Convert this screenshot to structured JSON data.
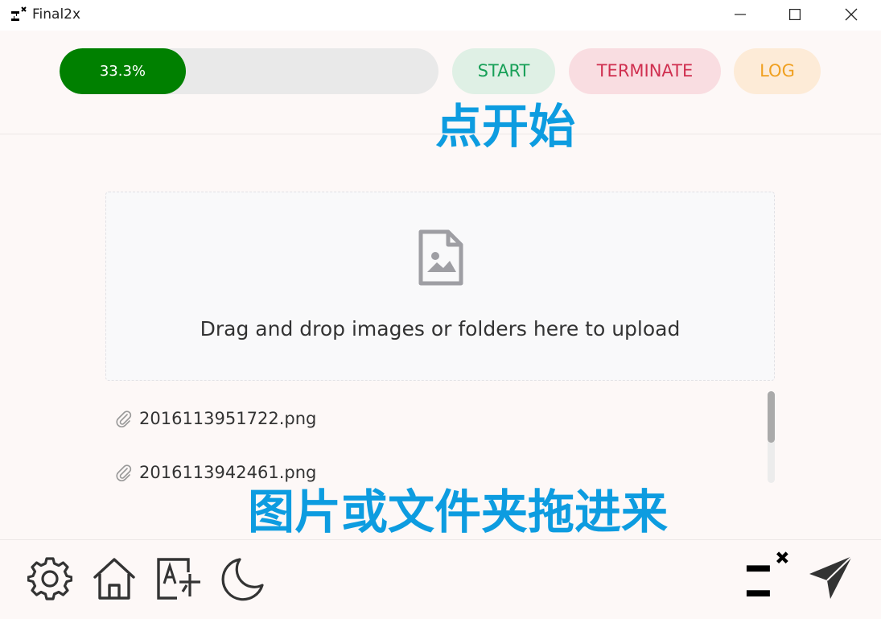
{
  "window": {
    "title": "Final2x",
    "controls": [
      "minimize",
      "maximize",
      "close"
    ]
  },
  "progress": {
    "value": 0.333,
    "label": "33.3%",
    "fill_color": "#008000"
  },
  "actions": {
    "start_label": "START",
    "terminate_label": "TERMINATE",
    "log_label": "LOG"
  },
  "annotations": {
    "start_hint": "点开始",
    "drag_hint": "图片或文件夹拖进来"
  },
  "dropzone": {
    "icon": "image-file-icon",
    "text": "Drag and drop images or folders here to upload"
  },
  "files": [
    {
      "name": "2016113951722.png",
      "icon": "paperclip-icon"
    },
    {
      "name": "2016113942461.png",
      "icon": "paperclip-icon"
    }
  ],
  "bottom_nav": {
    "left": [
      "gear-icon",
      "home-icon",
      "translate-icon",
      "moon-icon"
    ],
    "right": [
      "final2x-logo-icon",
      "send-icon"
    ]
  },
  "colors": {
    "accent_green": "#18a058",
    "accent_red": "#d03050",
    "accent_orange": "#f0a020",
    "annotation_blue": "#0d9ce0"
  }
}
